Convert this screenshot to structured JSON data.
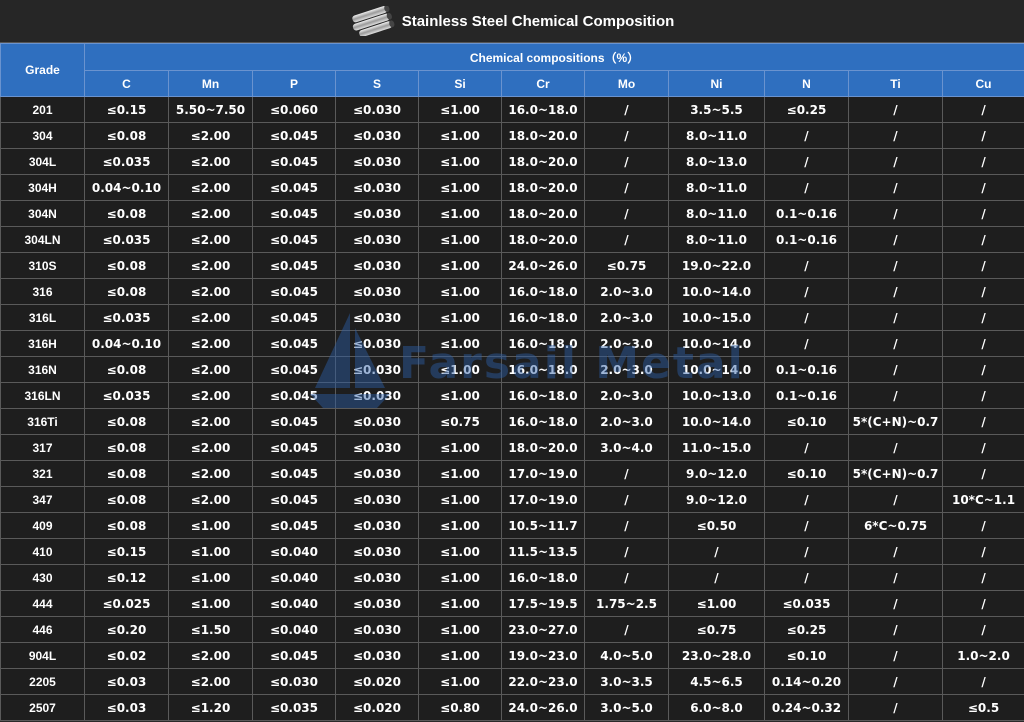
{
  "title": "Stainless Steel Chemical Composition",
  "header": {
    "grade_label": "Grade",
    "group_label": "Chemical compositions（%）",
    "elements": [
      "C",
      "Mn",
      "P",
      "S",
      "Si",
      "Cr",
      "Mo",
      "Ni",
      "N",
      "Ti",
      "Cu"
    ]
  },
  "rows": [
    [
      "201",
      "≤0.15",
      "5.50~7.50",
      "≤0.060",
      "≤0.030",
      "≤1.00",
      "16.0~18.0",
      "/",
      "3.5~5.5",
      "≤0.25",
      "/",
      "/"
    ],
    [
      "304",
      "≤0.08",
      "≤2.00",
      "≤0.045",
      "≤0.030",
      "≤1.00",
      "18.0~20.0",
      "/",
      "8.0~11.0",
      "/",
      "/",
      "/"
    ],
    [
      "304L",
      "≤0.035",
      "≤2.00",
      "≤0.045",
      "≤0.030",
      "≤1.00",
      "18.0~20.0",
      "/",
      "8.0~13.0",
      "/",
      "/",
      "/"
    ],
    [
      "304H",
      "0.04~0.10",
      "≤2.00",
      "≤0.045",
      "≤0.030",
      "≤1.00",
      "18.0~20.0",
      "/",
      "8.0~11.0",
      "/",
      "/",
      "/"
    ],
    [
      "304N",
      "≤0.08",
      "≤2.00",
      "≤0.045",
      "≤0.030",
      "≤1.00",
      "18.0~20.0",
      "/",
      "8.0~11.0",
      "0.1~0.16",
      "/",
      "/"
    ],
    [
      "304LN",
      "≤0.035",
      "≤2.00",
      "≤0.045",
      "≤0.030",
      "≤1.00",
      "18.0~20.0",
      "/",
      "8.0~11.0",
      "0.1~0.16",
      "/",
      "/"
    ],
    [
      "310S",
      "≤0.08",
      "≤2.00",
      "≤0.045",
      "≤0.030",
      "≤1.00",
      "24.0~26.0",
      "≤0.75",
      "19.0~22.0",
      "/",
      "/",
      "/"
    ],
    [
      "316",
      "≤0.08",
      "≤2.00",
      "≤0.045",
      "≤0.030",
      "≤1.00",
      "16.0~18.0",
      "2.0~3.0",
      "10.0~14.0",
      "/",
      "/",
      "/"
    ],
    [
      "316L",
      "≤0.035",
      "≤2.00",
      "≤0.045",
      "≤0.030",
      "≤1.00",
      "16.0~18.0",
      "2.0~3.0",
      "10.0~15.0",
      "/",
      "/",
      "/"
    ],
    [
      "316H",
      "0.04~0.10",
      "≤2.00",
      "≤0.045",
      "≤0.030",
      "≤1.00",
      "16.0~18.0",
      "2.0~3.0",
      "10.0~14.0",
      "/",
      "/",
      "/"
    ],
    [
      "316N",
      "≤0.08",
      "≤2.00",
      "≤0.045",
      "≤0.030",
      "≤1.00",
      "16.0~18.0",
      "2.0~3.0",
      "10.0~14.0",
      "0.1~0.16",
      "/",
      "/"
    ],
    [
      "316LN",
      "≤0.035",
      "≤2.00",
      "≤0.045",
      "≤0.030",
      "≤1.00",
      "16.0~18.0",
      "2.0~3.0",
      "10.0~13.0",
      "0.1~0.16",
      "/",
      "/"
    ],
    [
      "316Ti",
      "≤0.08",
      "≤2.00",
      "≤0.045",
      "≤0.030",
      "≤0.75",
      "16.0~18.0",
      "2.0~3.0",
      "10.0~14.0",
      "≤0.10",
      "5*(C+N)~0.7",
      "/"
    ],
    [
      "317",
      "≤0.08",
      "≤2.00",
      "≤0.045",
      "≤0.030",
      "≤1.00",
      "18.0~20.0",
      "3.0~4.0",
      "11.0~15.0",
      "/",
      "/",
      "/"
    ],
    [
      "321",
      "≤0.08",
      "≤2.00",
      "≤0.045",
      "≤0.030",
      "≤1.00",
      "17.0~19.0",
      "/",
      "9.0~12.0",
      "≤0.10",
      "5*(C+N)~0.7",
      "/"
    ],
    [
      "347",
      "≤0.08",
      "≤2.00",
      "≤0.045",
      "≤0.030",
      "≤1.00",
      "17.0~19.0",
      "/",
      "9.0~12.0",
      "/",
      "/",
      "10*C~1.1"
    ],
    [
      "409",
      "≤0.08",
      "≤1.00",
      "≤0.045",
      "≤0.030",
      "≤1.00",
      "10.5~11.7",
      "/",
      "≤0.50",
      "/",
      "6*C~0.75",
      "/"
    ],
    [
      "410",
      "≤0.15",
      "≤1.00",
      "≤0.040",
      "≤0.030",
      "≤1.00",
      "11.5~13.5",
      "/",
      "/",
      "/",
      "/",
      "/"
    ],
    [
      "430",
      "≤0.12",
      "≤1.00",
      "≤0.040",
      "≤0.030",
      "≤1.00",
      "16.0~18.0",
      "/",
      "/",
      "/",
      "/",
      "/"
    ],
    [
      "444",
      "≤0.025",
      "≤1.00",
      "≤0.040",
      "≤0.030",
      "≤1.00",
      "17.5~19.5",
      "1.75~2.5",
      "≤1.00",
      "≤0.035",
      "/",
      "/"
    ],
    [
      "446",
      "≤0.20",
      "≤1.50",
      "≤0.040",
      "≤0.030",
      "≤1.00",
      "23.0~27.0",
      "/",
      "≤0.75",
      "≤0.25",
      "/",
      "/"
    ],
    [
      "904L",
      "≤0.02",
      "≤2.00",
      "≤0.045",
      "≤0.030",
      "≤1.00",
      "19.0~23.0",
      "4.0~5.0",
      "23.0~28.0",
      "≤0.10",
      "/",
      "1.0~2.0"
    ],
    [
      "2205",
      "≤0.03",
      "≤2.00",
      "≤0.030",
      "≤0.020",
      "≤1.00",
      "22.0~23.0",
      "3.0~3.5",
      "4.5~6.5",
      "0.14~0.20",
      "/",
      "/"
    ],
    [
      "2507",
      "≤0.03",
      "≤1.20",
      "≤0.035",
      "≤0.020",
      "≤0.80",
      "24.0~26.0",
      "3.0~5.0",
      "6.0~8.0",
      "0.24~0.32",
      "/",
      "≤0.5"
    ]
  ],
  "watermark": {
    "text": "Farsail Metal"
  },
  "icons": {
    "title": "steel-pipes-icon",
    "watermark": "sailboat-logo-icon"
  },
  "colors": {
    "header_bg": "#2f6fbf",
    "cell_bg": "#1e1e1e",
    "text": "#ffffff"
  }
}
